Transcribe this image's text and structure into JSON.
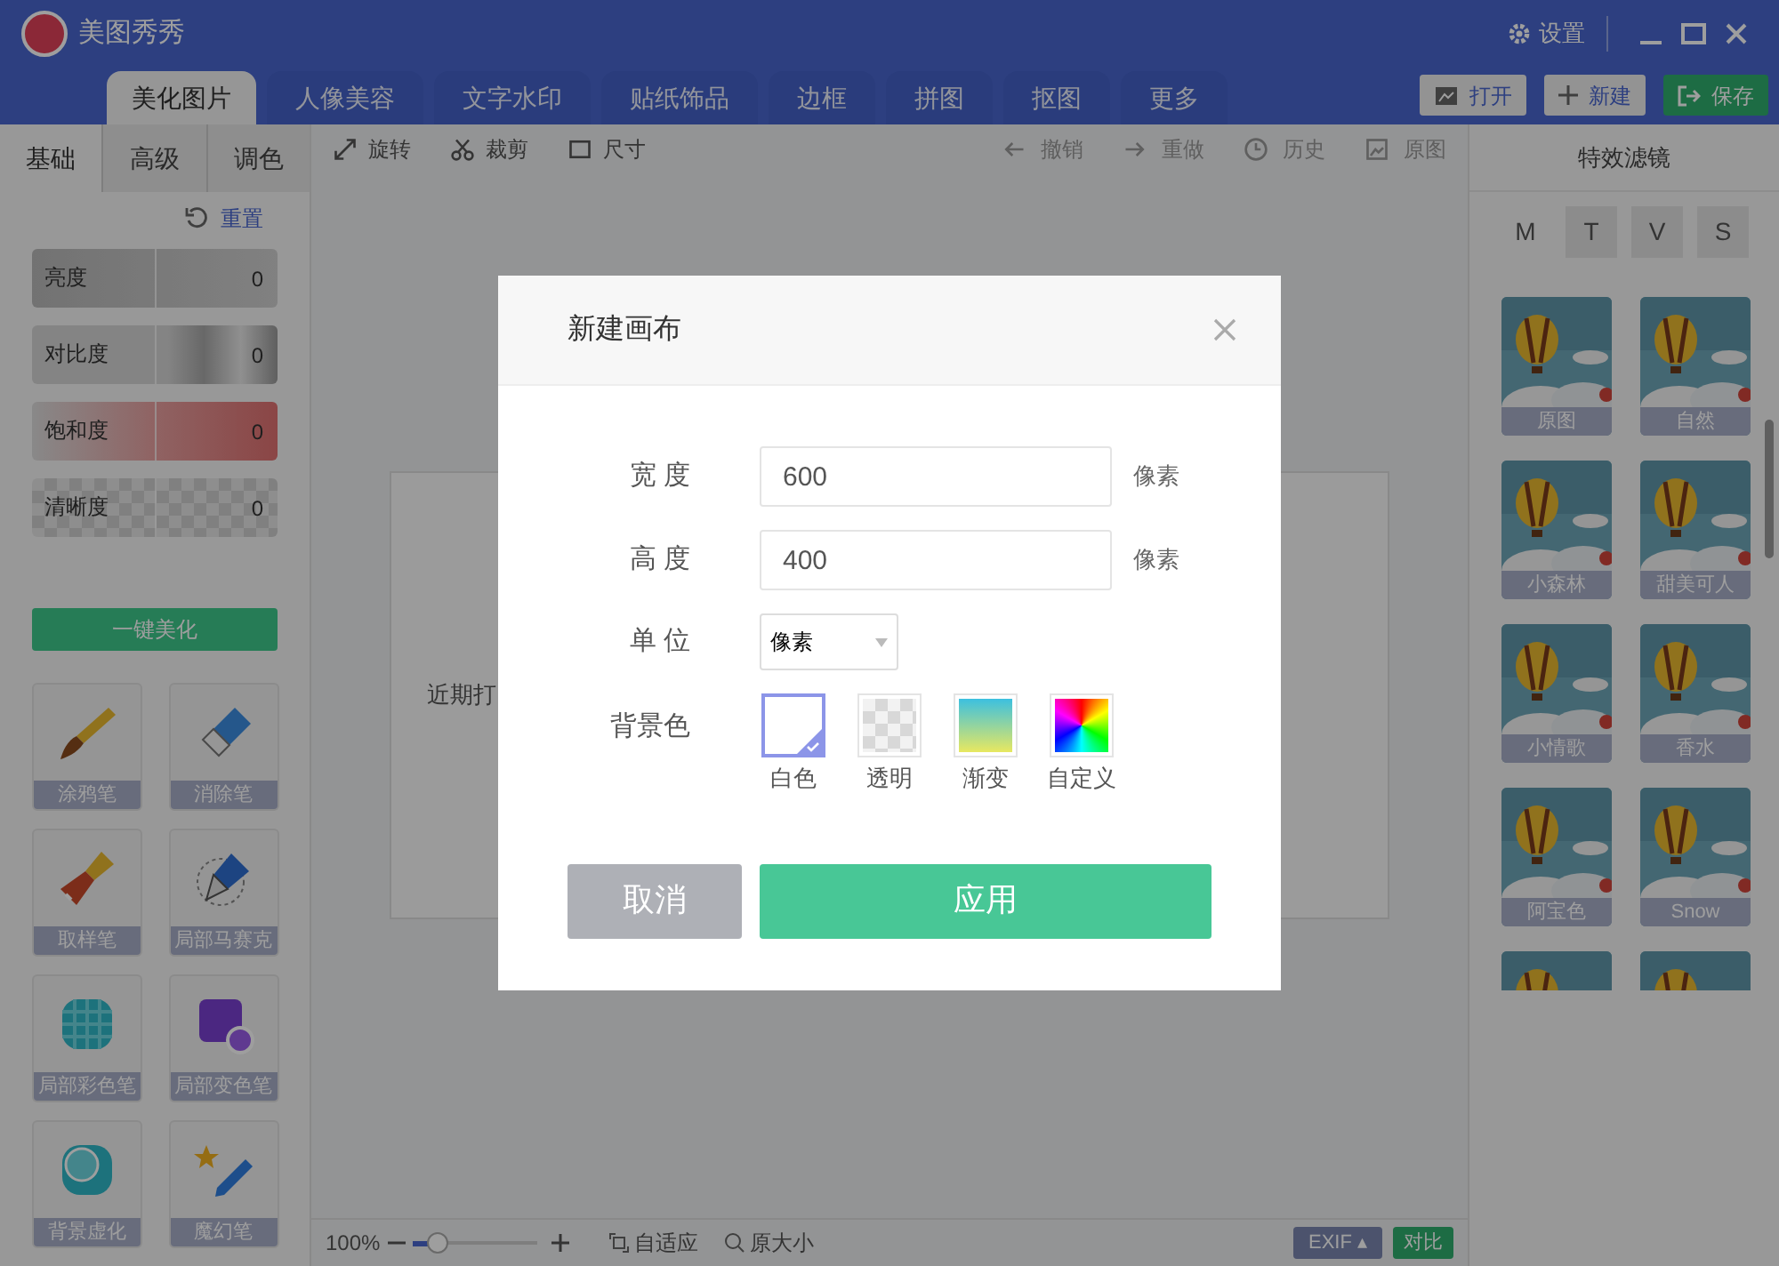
{
  "app": {
    "title": "美图秀秀",
    "settings": "设置"
  },
  "main_tabs": [
    {
      "label": "美化图片",
      "selected": true
    },
    {
      "label": "人像美容",
      "selected": false
    },
    {
      "label": "文字水印",
      "selected": false
    },
    {
      "label": "贴纸饰品",
      "selected": false
    },
    {
      "label": "边框",
      "selected": false
    },
    {
      "label": "拼图",
      "selected": false
    },
    {
      "label": "抠图",
      "selected": false
    },
    {
      "label": "更多",
      "selected": false
    }
  ],
  "actions": [
    {
      "label": "打开",
      "kind": "open"
    },
    {
      "label": "新建",
      "kind": "new"
    },
    {
      "label": "保存",
      "kind": "save"
    }
  ],
  "left_tabs": [
    {
      "label": "基础",
      "selected": true
    },
    {
      "label": "高级",
      "selected": false
    },
    {
      "label": "调色",
      "selected": false
    }
  ],
  "reset": "重置",
  "adjustments": [
    {
      "label": "亮度",
      "value": "0",
      "kind": "brightness"
    },
    {
      "label": "对比度",
      "value": "0",
      "kind": "contrast"
    },
    {
      "label": "饱和度",
      "value": "0",
      "kind": "saturation"
    },
    {
      "label": "清晰度",
      "value": "0",
      "kind": "sharpness"
    }
  ],
  "one_click": "一键美化",
  "tools": [
    {
      "label": "涂鸦笔",
      "kind": "brush"
    },
    {
      "label": "消除笔",
      "kind": "eraser"
    },
    {
      "label": "取样笔",
      "kind": "paintbrush"
    },
    {
      "label": "局部马赛克",
      "kind": "pen"
    },
    {
      "label": "局部彩色笔",
      "kind": "checker"
    },
    {
      "label": "局部变色笔",
      "kind": "purple"
    },
    {
      "label": "背景虚化",
      "kind": "blur"
    },
    {
      "label": "魔幻笔",
      "kind": "magic"
    }
  ],
  "toolbar_left": [
    {
      "label": "旋转",
      "kind": "rotate"
    },
    {
      "label": "裁剪",
      "kind": "crop"
    },
    {
      "label": "尺寸",
      "kind": "size"
    }
  ],
  "toolbar_right": [
    {
      "label": "撤销",
      "kind": "undo"
    },
    {
      "label": "重做",
      "kind": "redo"
    },
    {
      "label": "历史",
      "kind": "history"
    },
    {
      "label": "原图",
      "kind": "original"
    }
  ],
  "canvas": {
    "recent": "近期打"
  },
  "bottom": {
    "zoom": "100%",
    "zoom_slider": {
      "level": 0.2
    },
    "fit": "自适应",
    "actual": "原大小",
    "exif": "EXIF",
    "exif_caret": "▴",
    "compare": "对比"
  },
  "filters": {
    "title": "特效滤镜",
    "tabs": [
      {
        "label": "M",
        "selected": true
      },
      {
        "label": "T",
        "selected": false
      },
      {
        "label": "V",
        "selected": false
      },
      {
        "label": "S",
        "selected": false
      }
    ],
    "items": [
      {
        "label": "原图",
        "kind": "picture"
      },
      {
        "label": "自然",
        "kind": "picture"
      },
      {
        "label": "小森林",
        "kind": "picture"
      },
      {
        "label": "甜美可人",
        "kind": "picture"
      },
      {
        "label": "小情歌",
        "kind": "picture"
      },
      {
        "label": "香水",
        "kind": "picture"
      },
      {
        "label": "阿宝色",
        "kind": "picture"
      },
      {
        "label": "Snow",
        "kind": "picture"
      },
      {
        "kind": "picture"
      },
      {
        "kind": "picture"
      }
    ]
  },
  "dialog": {
    "title": "新建画布",
    "fields": [
      {
        "label": "宽 度",
        "value": "600",
        "unit": "像素"
      },
      {
        "label": "高 度",
        "value": "400",
        "unit": "像素"
      }
    ],
    "unit": {
      "label": "单 位",
      "value": "像素"
    },
    "background": {
      "label": "背景色",
      "options": [
        {
          "label": "白色",
          "kind": "white",
          "selected": true
        },
        {
          "label": "透明",
          "kind": "transparent",
          "selected": false
        },
        {
          "label": "渐变",
          "kind": "gradient",
          "selected": false
        },
        {
          "label": "自定义",
          "kind": "custom",
          "selected": false
        }
      ]
    },
    "cancel": "取消",
    "apply": "应用"
  }
}
